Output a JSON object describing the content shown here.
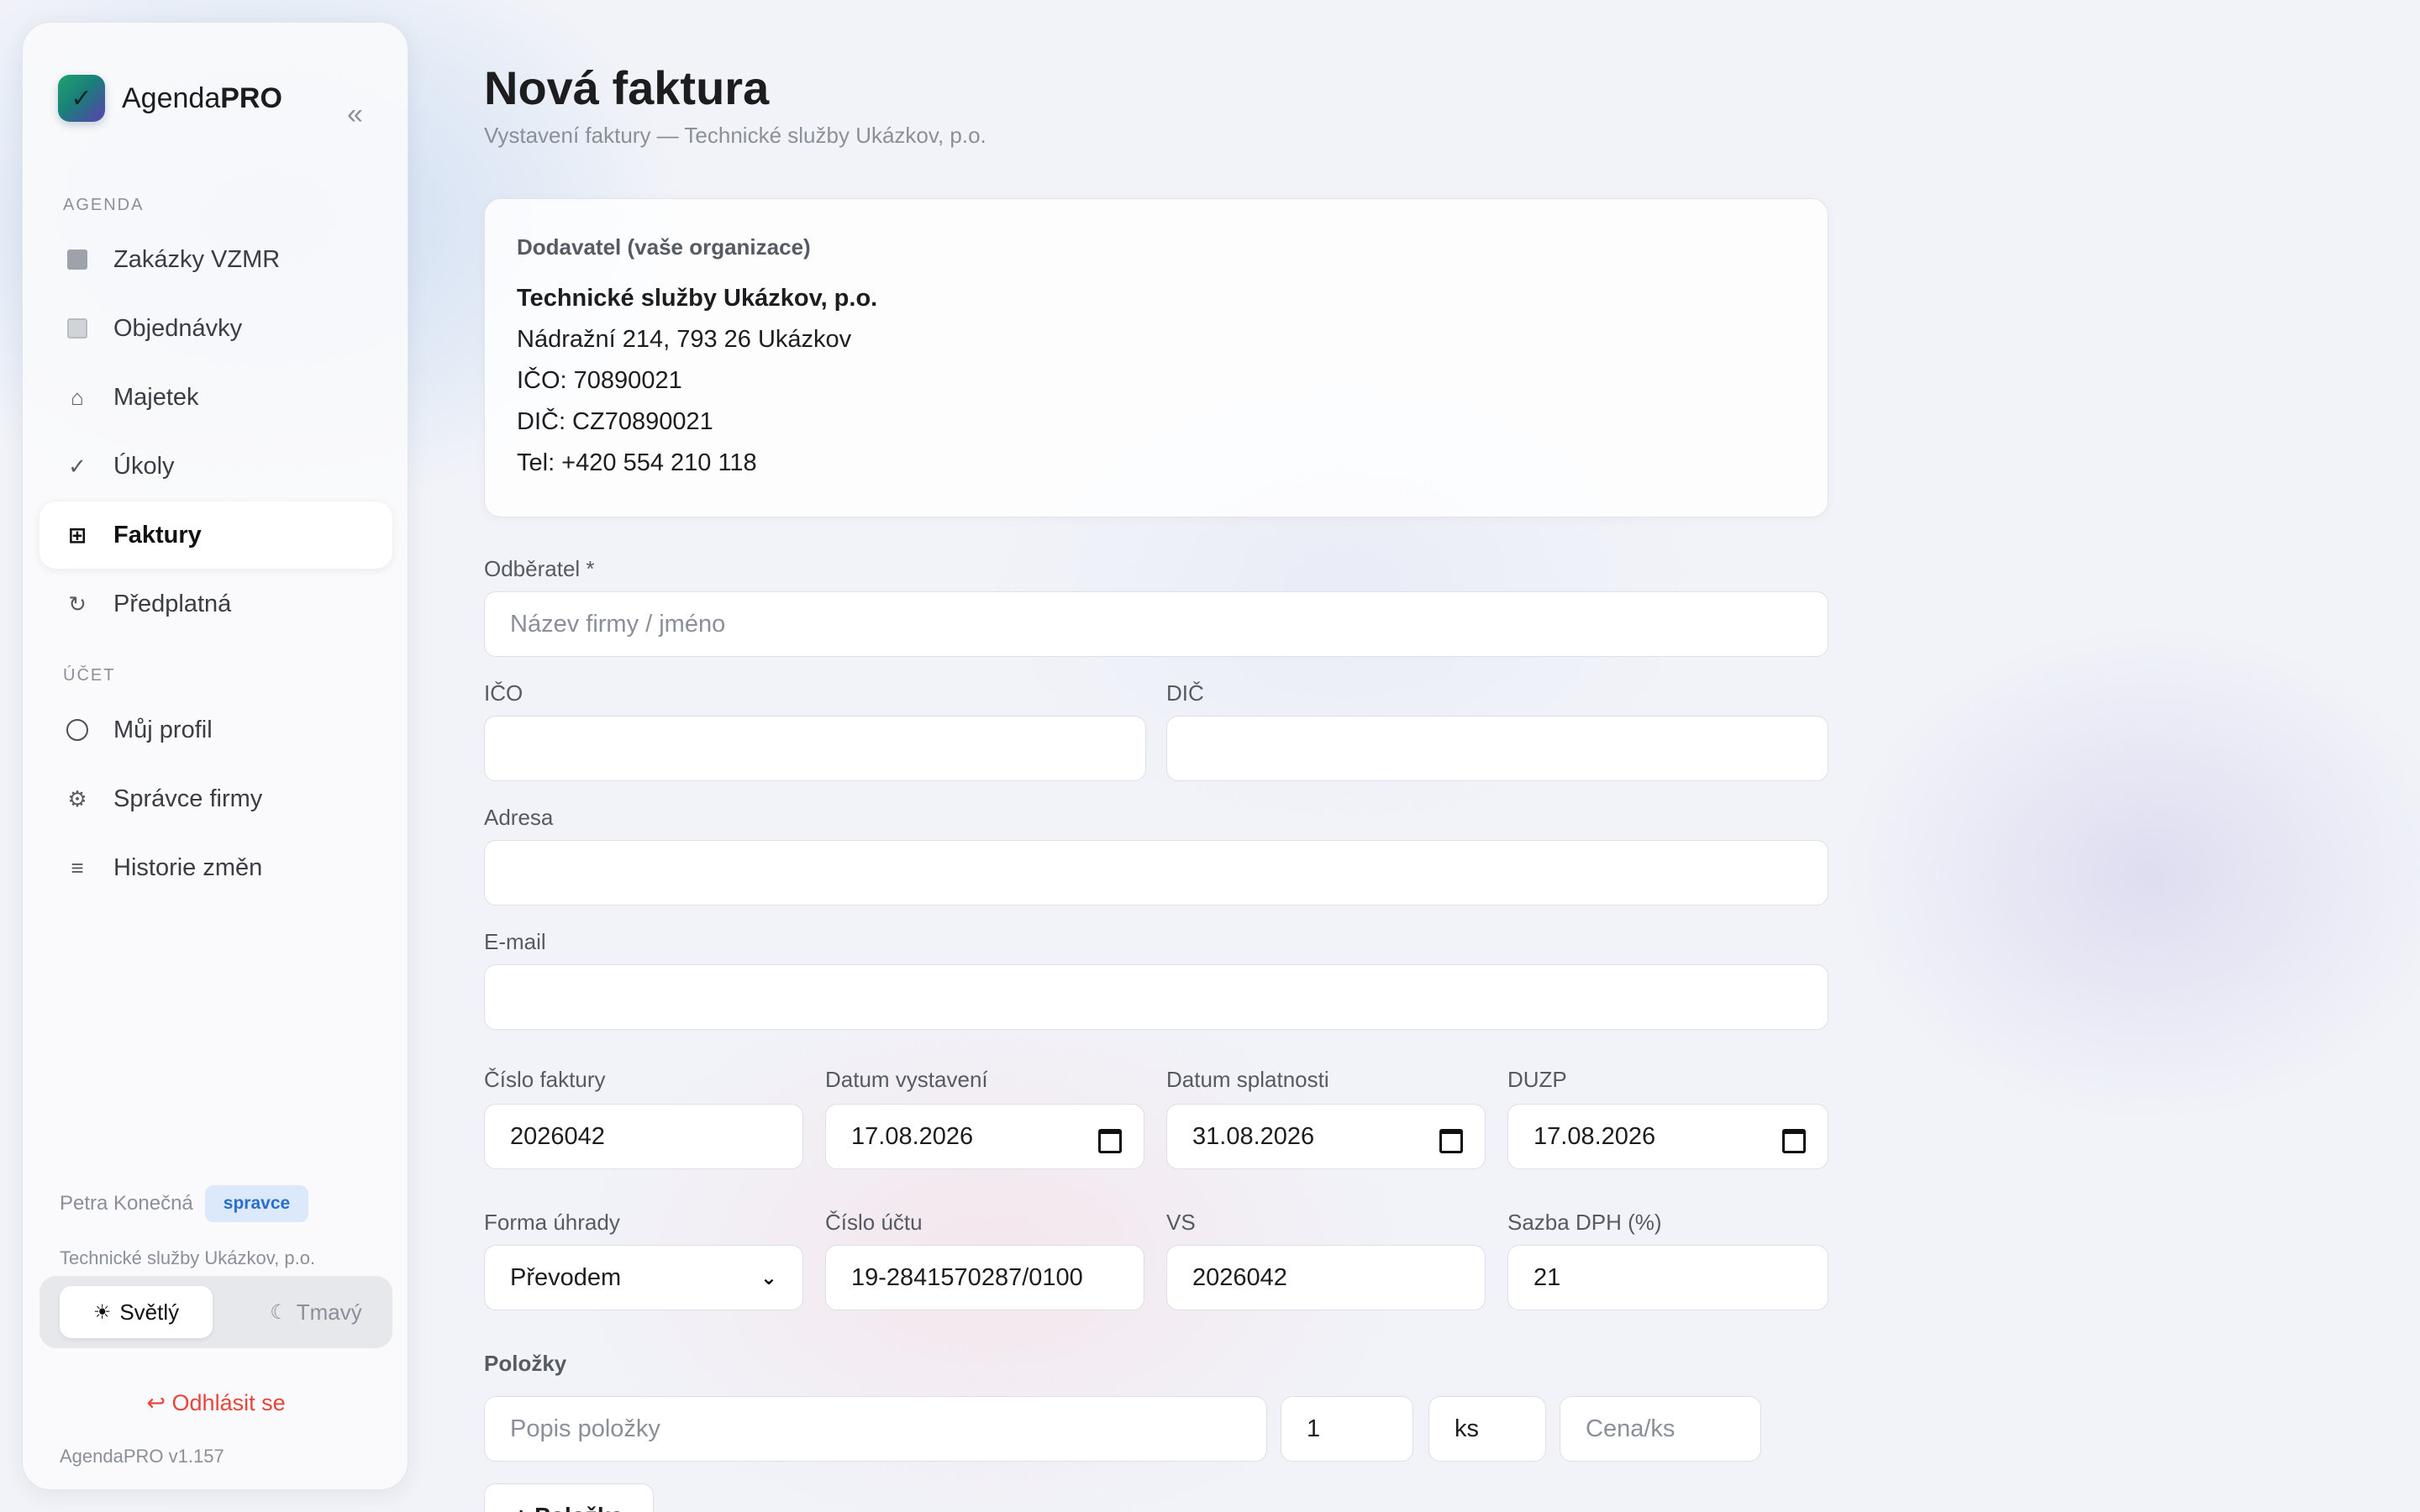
{
  "brand": {
    "name_plain": "Agenda",
    "name_bold": "PRO",
    "logo_check": "✓",
    "collapse": "«"
  },
  "nav": {
    "section_agenda": "AGENDA",
    "section_ucet": "ÚČET",
    "items": [
      {
        "label": "Zakázky VZMR",
        "icon": "square-filled-icon"
      },
      {
        "label": "Objednávky",
        "icon": "square-outline-icon"
      },
      {
        "label": "Majetek",
        "icon": "home-icon"
      },
      {
        "label": "Úkoly",
        "icon": "check-icon"
      },
      {
        "label": "Faktury",
        "icon": "grid-icon",
        "active": true
      },
      {
        "label": "Předplatná",
        "icon": "refresh-icon"
      },
      {
        "label": "Můj profil",
        "icon": "user-circle-icon"
      },
      {
        "label": "Správce firmy",
        "icon": "gear-icon"
      },
      {
        "label": "Historie změn",
        "icon": "list-icon"
      }
    ],
    "icon_glyphs": {
      "home": "⌂",
      "check": "✓",
      "grid": "⊞",
      "refresh": "↻",
      "gear": "⚙",
      "list": "≡"
    }
  },
  "user": {
    "name": "Petra Konečná",
    "role": "spravce",
    "org": "Technické služby Ukázkov, p.o."
  },
  "theme": {
    "light_label": "Světlý",
    "dark_label": "Tmavý",
    "light_icon": "☀",
    "dark_icon": "☾",
    "selected": "light"
  },
  "logout": {
    "icon": "↩",
    "label": "Odhlásit se"
  },
  "version": "AgendaPRO v1.157",
  "page": {
    "title": "Nová faktura",
    "subtitle": "Vystavení faktury — Technické služby Ukázkov, p.o."
  },
  "supplier": {
    "heading": "Dodavatel (vaše organizace)",
    "name": "Technické služby Ukázkov, p.o.",
    "address": "Nádražní 214, 793 26 Ukázkov",
    "ico": "IČO: 70890021",
    "dic": "DIČ: CZ70890021",
    "tel": "Tel: +420 554 210 118"
  },
  "form": {
    "customer_label": "Odběratel *",
    "customer_placeholder": "Název firmy / jméno",
    "ico_label": "IČO",
    "dic_label": "DIČ",
    "address_label": "Adresa",
    "email_label": "E-mail",
    "invoice_no_label": "Číslo faktury",
    "invoice_no": "2026042",
    "issue_date_label": "Datum vystavení",
    "issue_date": "17.08.2026",
    "due_date_label": "Datum splatnosti",
    "due_date": "31.08.2026",
    "duzp_label": "DUZP",
    "duzp": "17.08.2026",
    "payment_label": "Forma úhrady",
    "payment": "Převodem",
    "account_label": "Číslo účtu",
    "account": "19-2841570287/0100",
    "vs_label": "VS",
    "vs": "2026042",
    "vat_label": "Sazba DPH (%)",
    "vat": "21"
  },
  "items": {
    "label": "Položky",
    "desc_placeholder": "Popis položky",
    "qty": "1",
    "unit": "ks",
    "price_placeholder": "Cena/ks",
    "add_button": "+ Položka"
  }
}
